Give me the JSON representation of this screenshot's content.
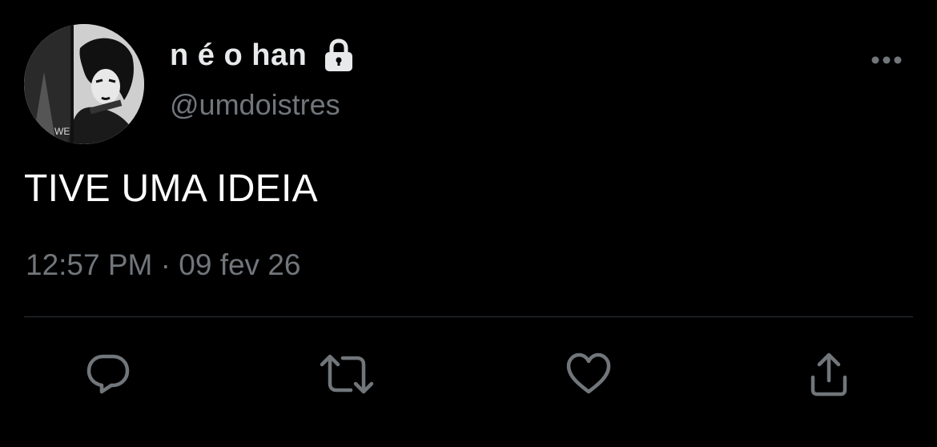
{
  "tweet": {
    "author": {
      "display_name": "n é o han",
      "handle": "@umdoistres",
      "protected": true,
      "avatar_icon": "avatar-illustration"
    },
    "more_icon": "more-horizontal-icon",
    "text": "TIVE UMA IDEIA",
    "time": "12:57 PM",
    "separator": "·",
    "date": "09 fev 26",
    "actions": [
      {
        "icon": "reply-icon"
      },
      {
        "icon": "retweet-icon"
      },
      {
        "icon": "like-icon"
      },
      {
        "icon": "share-icon"
      }
    ]
  },
  "colors": {
    "background": "#000000",
    "primary_text": "#e7e9ea",
    "secondary_text": "#71767b",
    "divider": "#2f3336"
  }
}
